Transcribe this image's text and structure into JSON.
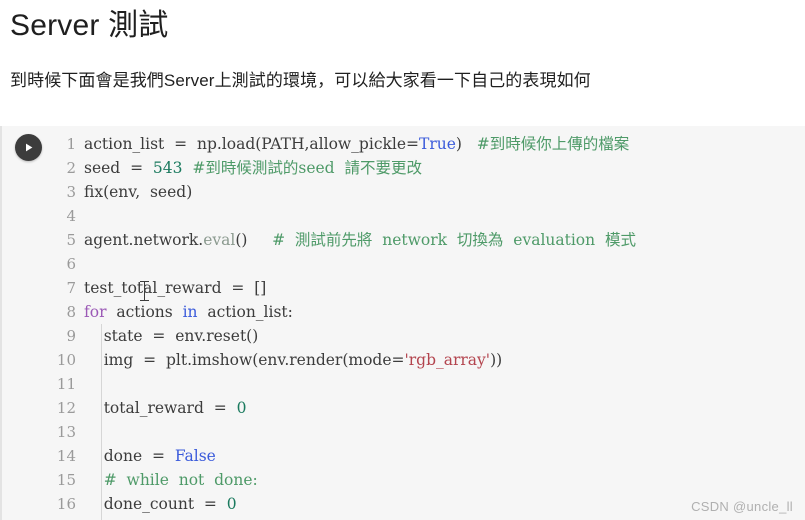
{
  "article": {
    "title": "Server 測試",
    "intro": "到時候下面會是我們Server上測試的環境，可以給大家看一下自己的表現如何"
  },
  "code_cell": {
    "run_button_label": "play-icon",
    "language": "python",
    "background_color": "#f6f6f6",
    "lines": [
      {
        "number": "1",
        "tokens": [
          {
            "text": "action_list  =  np.load(PATH,allow_pickle=",
            "type": "plain"
          },
          {
            "text": "True",
            "type": "const"
          },
          {
            "text": ")",
            "type": "plain"
          },
          {
            "text": "   ",
            "type": "plain"
          },
          {
            "text": "#到時候你上傳的檔案",
            "type": "comment"
          }
        ]
      },
      {
        "number": "2",
        "tokens": [
          {
            "text": "seed  =  ",
            "type": "plain"
          },
          {
            "text": "543",
            "type": "number"
          },
          {
            "text": "  ",
            "type": "plain"
          },
          {
            "text": "#到時候測試的seed  請不要更改",
            "type": "comment"
          }
        ]
      },
      {
        "number": "3",
        "tokens": [
          {
            "text": "fix(env,  seed)",
            "type": "plain"
          }
        ]
      },
      {
        "number": "4",
        "tokens": []
      },
      {
        "number": "5",
        "tokens": [
          {
            "text": "agent.network.",
            "type": "plain"
          },
          {
            "text": "eval",
            "type": "dim"
          },
          {
            "text": "()",
            "type": "plain"
          },
          {
            "text": "     ",
            "type": "plain"
          },
          {
            "text": "#  測試前先將  network  切換為  evaluation  模式",
            "type": "comment"
          }
        ]
      },
      {
        "number": "6",
        "tokens": []
      },
      {
        "number": "7",
        "tokens": [
          {
            "text": "test_total_reward  =  []",
            "type": "plain"
          }
        ]
      },
      {
        "number": "8",
        "tokens": [
          {
            "text": "for",
            "type": "kw"
          },
          {
            "text": "  actions  ",
            "type": "plain"
          },
          {
            "text": "in",
            "type": "kw2"
          },
          {
            "text": "  action_list:",
            "type": "plain"
          }
        ]
      },
      {
        "number": "9",
        "tokens": [
          {
            "text": "    state  =  env.reset()",
            "type": "plain"
          }
        ]
      },
      {
        "number": "10",
        "tokens": [
          {
            "text": "    img  =  plt.imshow(env.render(mode=",
            "type": "plain"
          },
          {
            "text": "'rgb_array'",
            "type": "string"
          },
          {
            "text": "))",
            "type": "plain"
          }
        ]
      },
      {
        "number": "11",
        "tokens": []
      },
      {
        "number": "12",
        "tokens": [
          {
            "text": "    total_reward  =  ",
            "type": "plain"
          },
          {
            "text": "0",
            "type": "number"
          }
        ]
      },
      {
        "number": "13",
        "tokens": []
      },
      {
        "number": "14",
        "tokens": [
          {
            "text": "    done  =  ",
            "type": "plain"
          },
          {
            "text": "False",
            "type": "const"
          }
        ]
      },
      {
        "number": "15",
        "tokens": [
          {
            "text": "    #  while  not  done:",
            "type": "comment"
          }
        ]
      },
      {
        "number": "16",
        "tokens": [
          {
            "text": "    done_count  =  ",
            "type": "plain"
          },
          {
            "text": "0",
            "type": "number"
          }
        ]
      }
    ]
  },
  "watermark": "CSDN @uncle_ll"
}
